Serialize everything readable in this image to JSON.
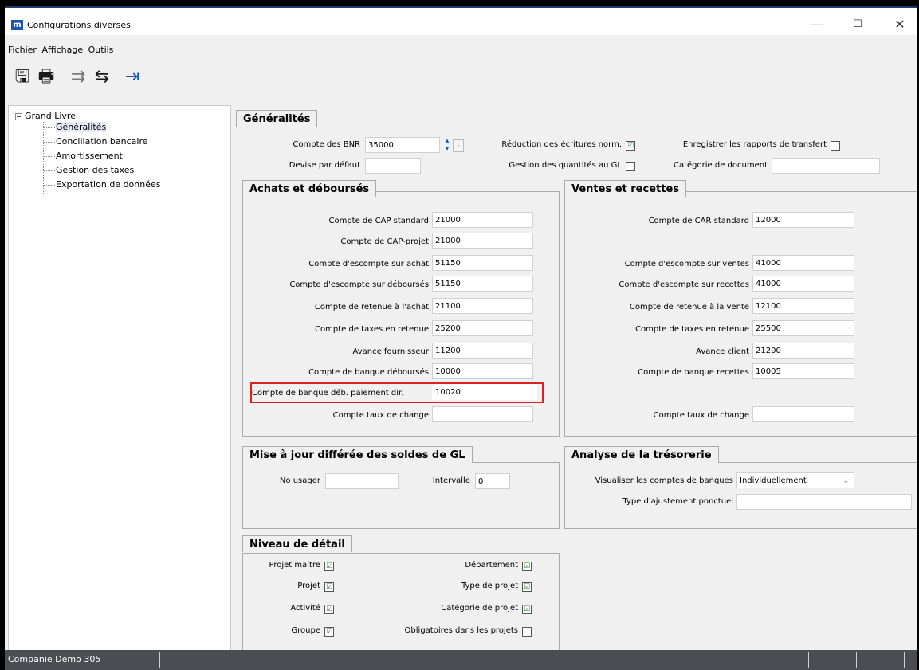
{
  "window": {
    "title": "Configurations diverses",
    "app_icon_letter": "m",
    "minimize": "—",
    "maximize": "☐",
    "close": "✕"
  },
  "menu": [
    "Fichier",
    "Affichage",
    "Outils"
  ],
  "toolbar": [
    {
      "icon": "save-icon",
      "glyph": "🖫"
    },
    {
      "icon": "print-icon",
      "glyph": "🖶"
    },
    {
      "icon": "transfer-icon",
      "glyph": "⇉"
    },
    {
      "icon": "compare-icon",
      "glyph": "⇆"
    },
    {
      "icon": "exit-icon",
      "glyph": "⇥"
    }
  ],
  "tree": {
    "root": "Grand Livre",
    "items": [
      "Généralités",
      "Conciliation bancaire",
      "Amortissement",
      "Gestion des taxes",
      "Exportation de données"
    ],
    "selected": "Généralités"
  },
  "general": {
    "tab": "Généralités",
    "compte_bnr_label": "Compte des BNR",
    "compte_bnr_value": "35000",
    "devise_label": "Devise par défaut",
    "devise_value": "",
    "reduction_label": "Réduction des écritures norm.",
    "reduction_checked": "☑",
    "gestion_label": "Gestion des quantités au GL",
    "gestion_checked": "",
    "enregistrer_label": "Enregistrer les rapports de transfert",
    "enregistrer_checked": "",
    "categorie_doc_label": "Catégorie de document",
    "categorie_doc_value": ""
  },
  "achats": {
    "title": "Achats et déboursés",
    "rows": [
      {
        "label": "Compte de CAP standard",
        "value": "21000"
      },
      {
        "label": "Compte de CAP-projet",
        "value": "21000"
      },
      {
        "label": "Compte d'escompte sur achat",
        "value": "51150"
      },
      {
        "label": "Compte d'escompte sur déboursés",
        "value": "51150"
      },
      {
        "label": "Compte de retenue à l'achat",
        "value": "21100"
      },
      {
        "label": "Compte de taxes en retenue",
        "value": "25200"
      },
      {
        "label": "Avance fournisseur",
        "value": "11200"
      },
      {
        "label": "Compte de banque déboursés",
        "value": "10000"
      },
      {
        "label": "Compte de banque déb. paiement dir.",
        "value": "10020"
      },
      {
        "label": "Compte taux de change",
        "value": ""
      }
    ]
  },
  "ventes": {
    "title": "Ventes et recettes",
    "rows": [
      {
        "label": "Compte de CAR standard",
        "value": "12000"
      },
      {
        "label": "Compte d'escompte sur ventes",
        "value": "41000"
      },
      {
        "label": "Compte d'escompte sur recettes",
        "value": "41000"
      },
      {
        "label": "Compte de retenue à la vente",
        "value": "12100"
      },
      {
        "label": "Compte de taxes en retenue",
        "value": "25500"
      },
      {
        "label": "Avance client",
        "value": "21200"
      },
      {
        "label": "Compte de banque recettes",
        "value": "10005"
      },
      {
        "label": "Compte taux de change",
        "value": ""
      }
    ]
  },
  "miseajour": {
    "title": "Mise à jour différée des soldes de GL",
    "usager_label": "No usager",
    "usager_value": "",
    "intervalle_label": "Intervalle",
    "intervalle_value": "0"
  },
  "tresorerie": {
    "title": "Analyse de la trésorerie",
    "visualiser_label": "Visualiser les comptes de banques",
    "visualiser_value": "Individuellement",
    "ajustement_label": "Type d'ajustement ponctuel",
    "ajustement_value": ""
  },
  "niveau": {
    "title": "Niveau de détail",
    "left": [
      {
        "label": "Projet maître",
        "checked": "☑"
      },
      {
        "label": "Projet",
        "checked": "☑"
      },
      {
        "label": "Activité",
        "checked": "☑"
      },
      {
        "label": "Groupe",
        "checked": "☑"
      }
    ],
    "right": [
      {
        "label": "Département",
        "checked": "☑"
      },
      {
        "label": "Type de projet",
        "checked": "☑"
      },
      {
        "label": "Catégorie de projet",
        "checked": "☑"
      },
      {
        "label": "Obligatoires dans les projets",
        "checked": ""
      }
    ]
  },
  "status": {
    "company": "Companie Demo 305"
  }
}
